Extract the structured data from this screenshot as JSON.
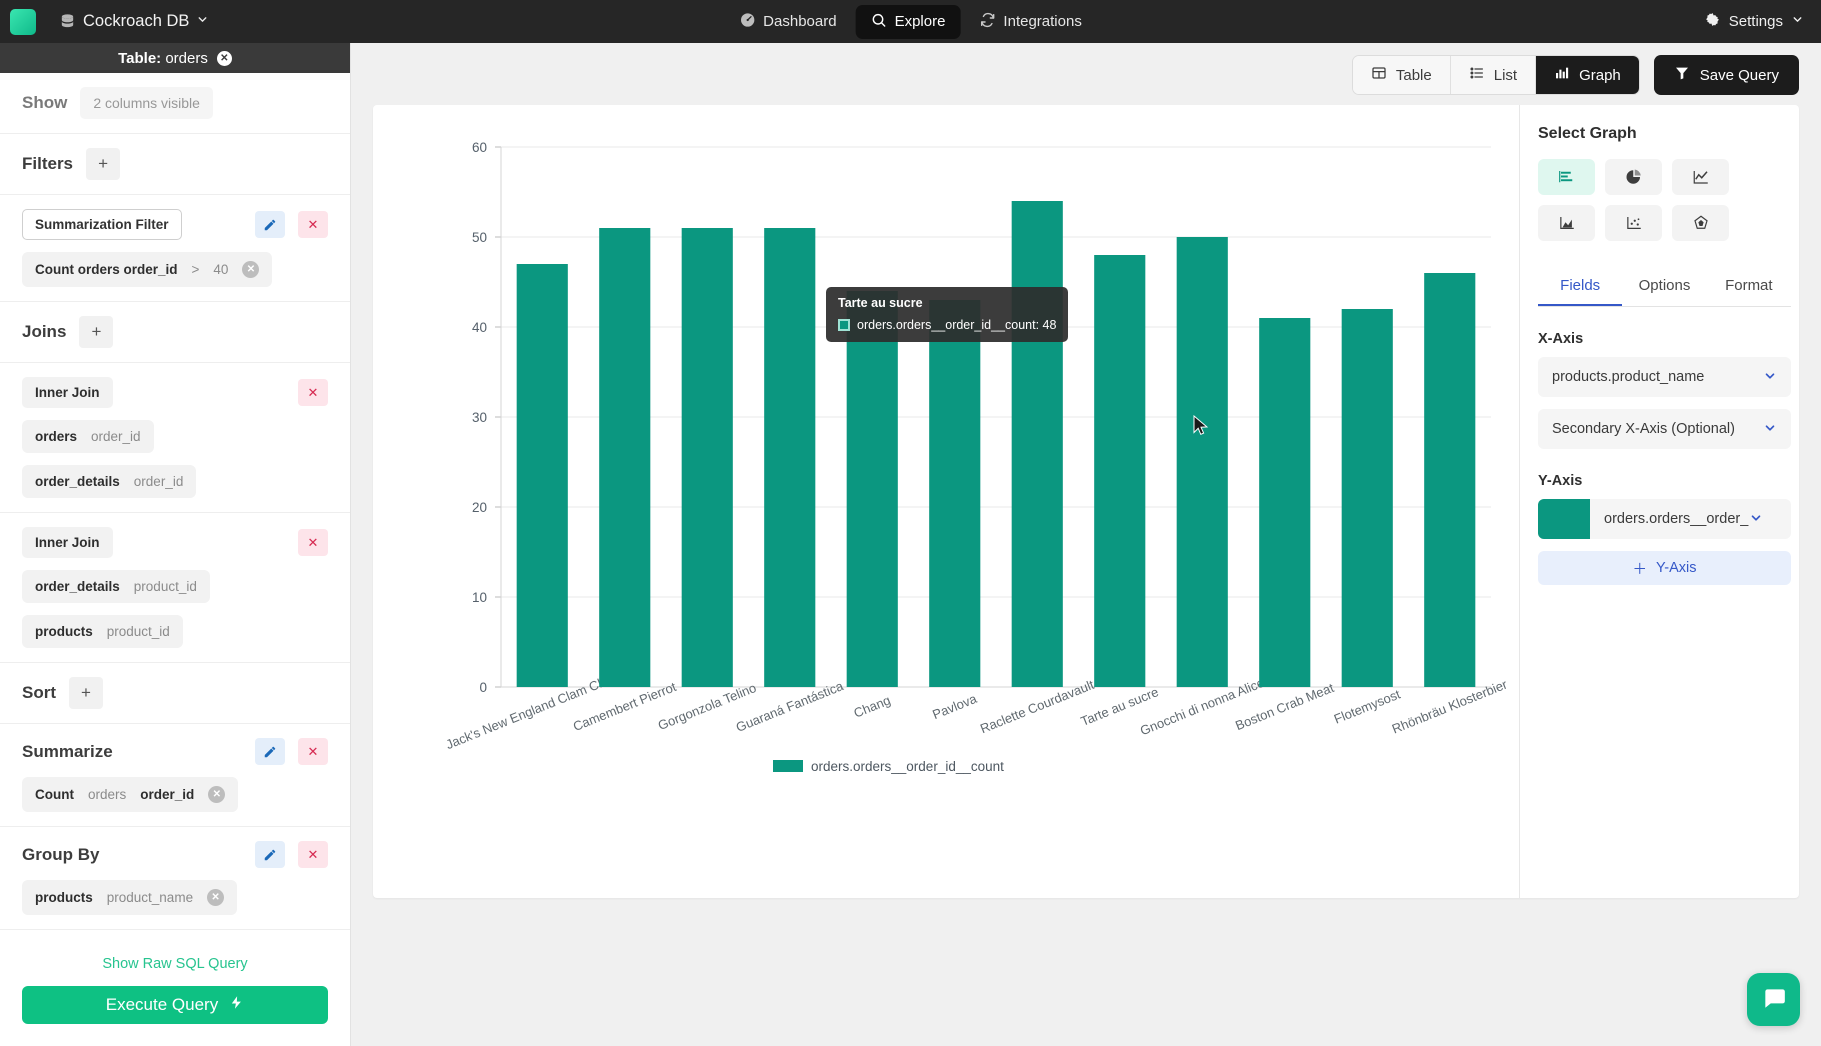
{
  "topbar": {
    "db_name": "Cockroach DB",
    "db_icon": "database-icon",
    "nav": [
      {
        "label": "Dashboard",
        "icon": "gauge-icon",
        "active": false
      },
      {
        "label": "Explore",
        "icon": "search-icon",
        "active": true
      },
      {
        "label": "Integrations",
        "icon": "sync-icon",
        "active": false
      }
    ],
    "settings_label": "Settings"
  },
  "sidebar": {
    "header_prefix": "Table:",
    "header_table": "orders",
    "show": {
      "label": "Show",
      "value": "2 columns visible"
    },
    "filters": {
      "title": "Filters",
      "add": "+",
      "item_name": "Summarization Filter",
      "chip": {
        "field": "Count orders order_id",
        "operator": ">",
        "value": "40"
      }
    },
    "joins": {
      "title": "Joins",
      "add": "+",
      "items": [
        {
          "type": "Inner Join",
          "left_table": "orders",
          "left_col": "order_id",
          "right_table": "order_details",
          "right_col": "order_id"
        },
        {
          "type": "Inner Join",
          "left_table": "order_details",
          "left_col": "product_id",
          "right_table": "products",
          "right_col": "product_id"
        }
      ]
    },
    "sort": {
      "title": "Sort",
      "add": "+"
    },
    "summarize": {
      "title": "Summarize",
      "fn": "Count",
      "table": "orders",
      "column": "order_id"
    },
    "group_by": {
      "title": "Group By",
      "table": "products",
      "column": "product_name"
    },
    "raw_sql_link": "Show Raw SQL Query",
    "execute_label": "Execute Query"
  },
  "toolbar": {
    "views": [
      {
        "label": "Table",
        "icon": "table-icon",
        "active": false
      },
      {
        "label": "List",
        "icon": "list-icon",
        "active": false
      },
      {
        "label": "Graph",
        "icon": "bar-chart-icon",
        "active": true
      }
    ],
    "save_label": "Save Query",
    "save_icon": "funnel-icon"
  },
  "right_panel": {
    "select_graph_title": "Select Graph",
    "graph_types": [
      {
        "name": "bar-chart-icon",
        "active": true
      },
      {
        "name": "pie-chart-icon",
        "active": false
      },
      {
        "name": "line-chart-icon",
        "active": false
      },
      {
        "name": "area-chart-icon",
        "active": false
      },
      {
        "name": "scatter-chart-icon",
        "active": false
      },
      {
        "name": "radar-chart-icon",
        "active": false
      }
    ],
    "tabs": [
      {
        "label": "Fields",
        "active": true
      },
      {
        "label": "Options",
        "active": false
      },
      {
        "label": "Format",
        "active": false
      }
    ],
    "x_axis_label": "X-Axis",
    "x_axis_value": "products.product_name",
    "x_axis_secondary_placeholder": "Secondary X-Axis (Optional)",
    "y_axis_label": "Y-Axis",
    "y_axis_value": "orders.orders__order_id_",
    "y_axis_color": "#0b9780",
    "add_y_axis_label": "Y-Axis"
  },
  "tooltip": {
    "title": "Tarte au sucre",
    "series_label": "orders.orders__order_id__count",
    "value": "48",
    "text": "orders.orders__order_id__count: 48"
  },
  "chart_data": {
    "type": "bar",
    "title": "",
    "xlabel": "",
    "ylabel": "",
    "ylim": [
      0,
      60
    ],
    "yticks": [
      0,
      10,
      20,
      30,
      40,
      50,
      60
    ],
    "grid": true,
    "legend_position": "bottom",
    "series_name": "orders.orders__order_id__count",
    "color": "#0b9780",
    "categories": [
      "Jack's New England Clam Chowder",
      "Camembert Pierrot",
      "Gorgonzola Telino",
      "Guaraná Fantástica",
      "Chang",
      "Pavlova",
      "Raclette Courdavault",
      "Tarte au sucre",
      "Gnocchi di nonna Alice",
      "Boston Crab Meat",
      "Flotemysost",
      "Rhönbräu Klosterbier"
    ],
    "values": [
      47,
      51,
      51,
      51,
      44,
      43,
      54,
      48,
      50,
      41,
      42,
      46
    ]
  },
  "chat_fab": {
    "icon": "chat-icon"
  }
}
